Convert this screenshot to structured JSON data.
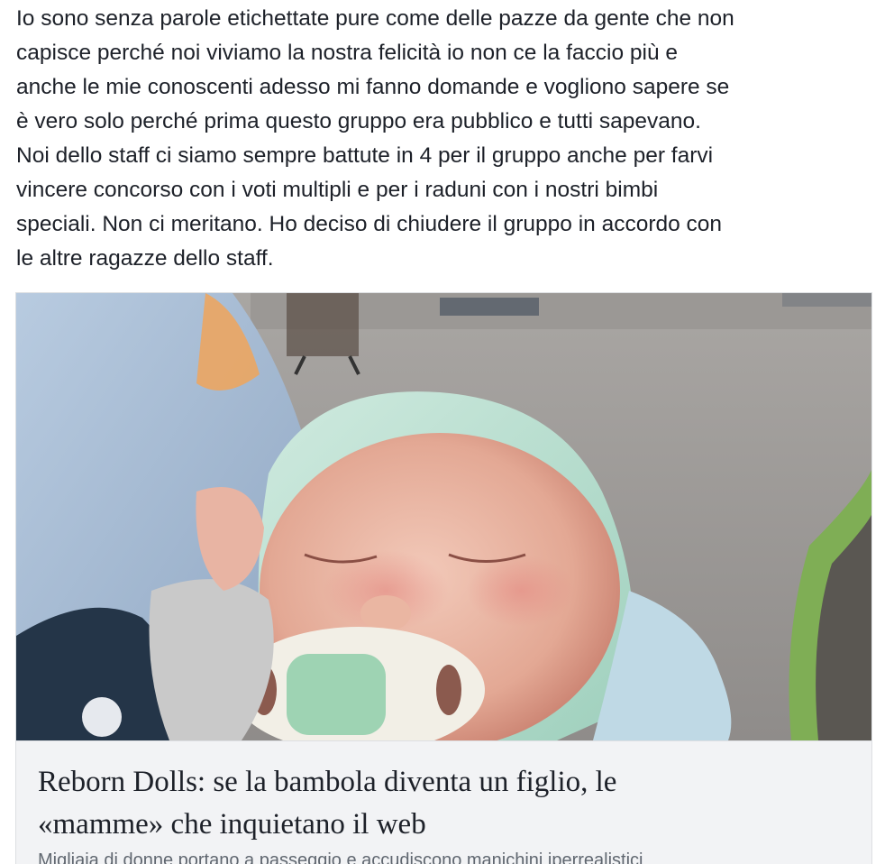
{
  "post": {
    "text_lines": [
      "Io sono senza parole etichettate pure come delle pazze da gente che non",
      "capisce perché noi viviamo la nostra felicità io non ce la faccio più e",
      "anche le mie conoscenti adesso mi fanno domande e vogliono sapere se",
      "è vero solo perché prima questo gruppo era pubblico e tutti sapevano.",
      "Noi dello staff ci siamo sempre battute in 4 per il gruppo anche per farvi",
      "vincere concorso con i voti multipli e per i raduni con i nostri bimbi",
      "speciali. Non ci meritano. Ho deciso di chiudere il gruppo in accordo con",
      "le altre ragazze dello staff."
    ]
  },
  "link_card": {
    "image_subject": "reborn-doll-photo",
    "title_lines": [
      "Reborn Dolls: se la bambola diventa un figlio, le",
      "«mamme» che inquietano il web"
    ],
    "description": "Migliaia di donne portano a passeggio e accudiscono manichini iperrealistici"
  },
  "colors": {
    "text": "#1d2129",
    "card_bg": "#f2f3f5",
    "card_border": "#dddfe2",
    "muted": "#606770"
  }
}
